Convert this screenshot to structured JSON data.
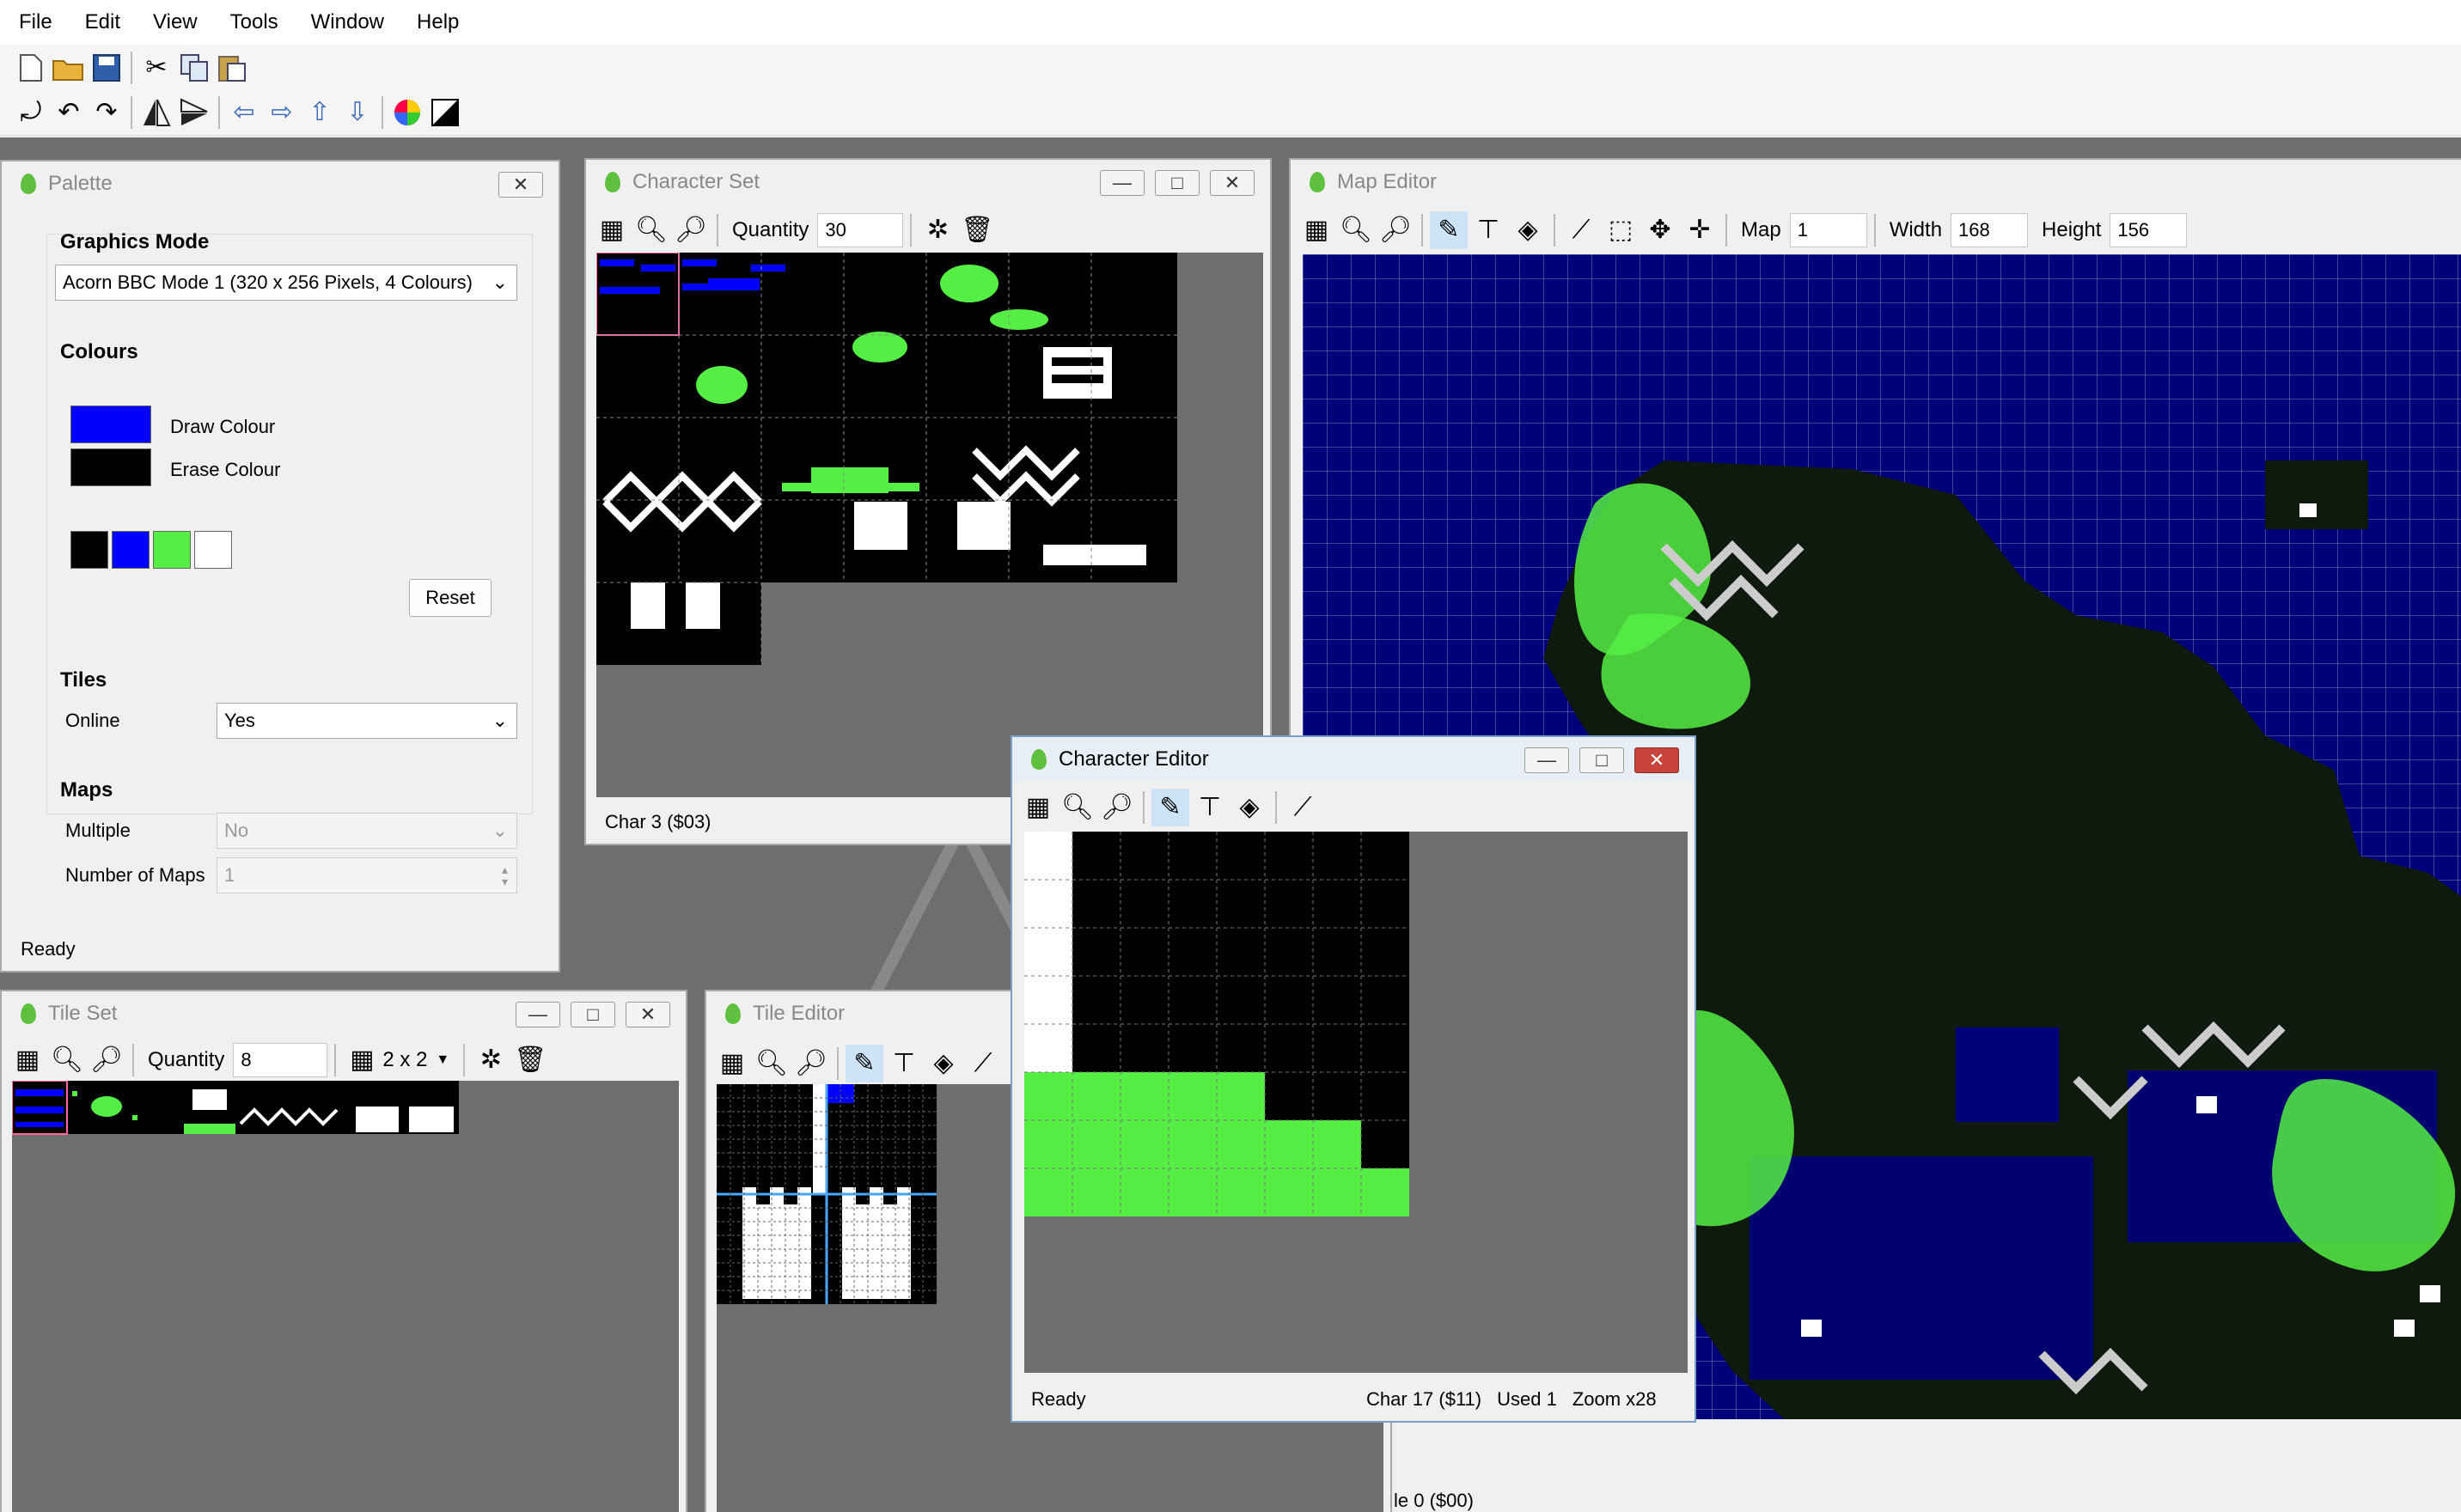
{
  "menubar": [
    "File",
    "Edit",
    "View",
    "Tools",
    "Window",
    "Help"
  ],
  "toolbar": {
    "row1": [
      "new-file-icon",
      "open-folder-icon",
      "save-icon",
      "cut-icon",
      "copy-icon",
      "paste-icon"
    ],
    "row2": [
      "rotate-icon",
      "rotate-left-icon",
      "rotate-right-icon",
      "flip-horizontal-icon",
      "flip-vertical-icon",
      "shift-left-icon",
      "shift-right-icon",
      "shift-up-icon",
      "shift-down-icon",
      "color-wheel-icon",
      "invert-icon"
    ]
  },
  "palette": {
    "title": "Palette",
    "graphics_mode_label": "Graphics Mode",
    "graphics_mode_value": "Acorn BBC Mode 1 (320 x 256 Pixels, 4  Colours)",
    "colours_label": "Colours",
    "draw_colour_label": "Draw Colour",
    "erase_colour_label": "Erase Colour",
    "draw_colour": "#0000ff",
    "erase_colour": "#000000",
    "swatches": [
      "#000000",
      "#0000ff",
      "#55ee44",
      "#ffffff"
    ],
    "reset_label": "Reset",
    "tiles_label": "Tiles",
    "online_label": "Online",
    "online_value": "Yes",
    "maps_label": "Maps",
    "multiple_label": "Multiple",
    "multiple_value": "No",
    "number_of_maps_label": "Number of Maps",
    "number_of_maps_value": "1",
    "status": "Ready"
  },
  "character_set": {
    "title": "Character Set",
    "quantity_label": "Quantity",
    "quantity_value": "30",
    "status": "Char 3 ($03)"
  },
  "map_editor": {
    "title": "Map Editor",
    "map_label": "Map",
    "map_value": "1",
    "width_label": "Width",
    "width_value": "168",
    "height_label": "Height",
    "height_value": "156",
    "status": "le 0 ($00)"
  },
  "tile_set": {
    "title": "Tile Set",
    "quantity_label": "Quantity",
    "quantity_value": "8",
    "tile_size": "2 x 2"
  },
  "tile_editor": {
    "title": "Tile Editor"
  },
  "character_editor": {
    "title": "Character Editor",
    "status_left": "Ready",
    "status_char": "Char 17 ($11)",
    "status_used": "Used 1",
    "status_zoom": "Zoom x28"
  },
  "colors": {
    "blue": "#0000ff",
    "green": "#55ee44",
    "map_sea": "#00007a",
    "map_land": "#0e1a0e"
  }
}
